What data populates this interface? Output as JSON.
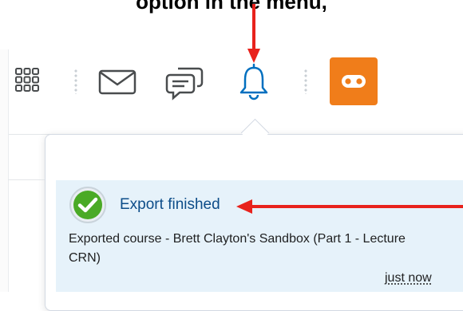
{
  "caption": "option in the menu,",
  "navbar": {
    "icons": [
      "app-grid-icon",
      "mail-icon",
      "chat-icon",
      "bell-icon",
      "mask-icon"
    ],
    "accent_color": "#006fbf",
    "badge_color": "#f07d1a"
  },
  "notification": {
    "title": "Export finished",
    "body": "Exported course - Brett Clayton's Sandbox (Part 1 - Lecture CRN)",
    "time": "just now",
    "status_icon": "check-circle-icon",
    "background": "#e6f2fa"
  },
  "annotations": {
    "arrow_color": "#e8221c"
  }
}
